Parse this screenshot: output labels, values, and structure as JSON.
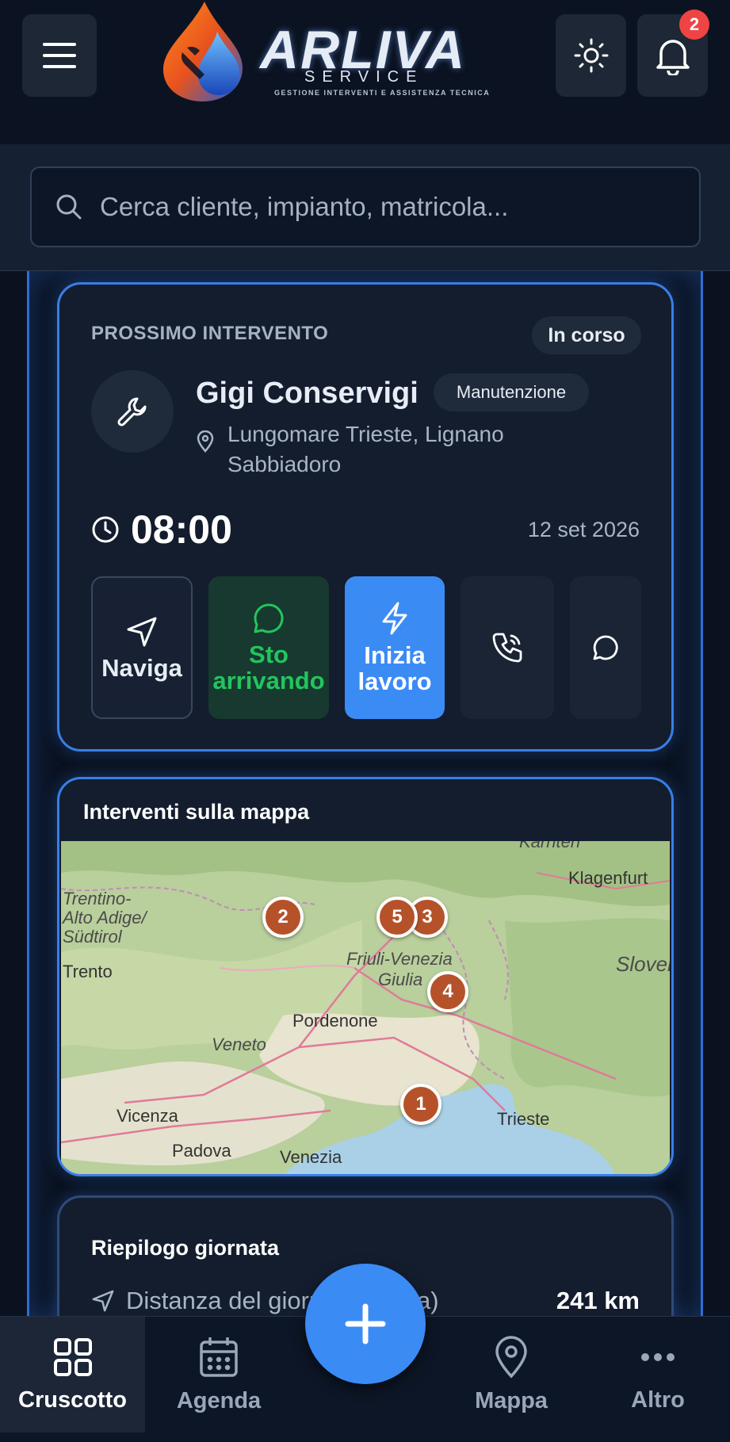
{
  "header": {
    "logo_title": "ARLIVA",
    "logo_subtitle": "SERVICE",
    "logo_tagline": "GESTIONE INTERVENTI E ASSISTENZA TECNICA",
    "notification_count": "2"
  },
  "search": {
    "placeholder": "Cerca cliente, impianto, matricola..."
  },
  "next_job": {
    "section_label": "PROSSIMO INTERVENTO",
    "status": "In corso",
    "client": "Gigi Conservigi",
    "type": "Manutenzione",
    "address_line1": "Lungomare Trieste, Lignano",
    "address_line2": "Sabbiadoro",
    "time": "08:00",
    "date": "12 set 2026",
    "actions": {
      "navigate": "Naviga",
      "arriving_1": "Sto",
      "arriving_2": "arrivando",
      "start_1": "Inizia",
      "start_2": "lavoro"
    }
  },
  "map": {
    "title": "Interventi sulla mappa",
    "labels": {
      "trentino1": "Trentino-",
      "trentino2": "Alto Adige/",
      "trentino3": "Südtirol",
      "trento": "Trento",
      "fvg1": "Friuli-Venezia",
      "fvg2": "Giulia",
      "veneto": "Veneto",
      "slovenia": "Slovenija",
      "karnten": "Kärnten"
    },
    "cities": {
      "klagenfurt": "Klagenfurt",
      "pordenone": "Pordenone",
      "vicenza": "Vicenza",
      "padova": "Padova",
      "venezia": "Venezia",
      "trieste": "Trieste"
    },
    "markers": [
      "1",
      "2",
      "3",
      "4",
      "5"
    ]
  },
  "summary": {
    "title": "Riepilogo giornata",
    "distance_label": "Distanza del giorno (stimata)",
    "distance_value": "241 km"
  },
  "bottom_nav": {
    "dashboard": "Cruscotto",
    "agenda": "Agenda",
    "map": "Mappa",
    "more": "Altro"
  },
  "colors": {
    "accent": "#3b8bf5",
    "success": "#22c55e",
    "danger": "#ef4444",
    "marker": "#b5522a"
  }
}
